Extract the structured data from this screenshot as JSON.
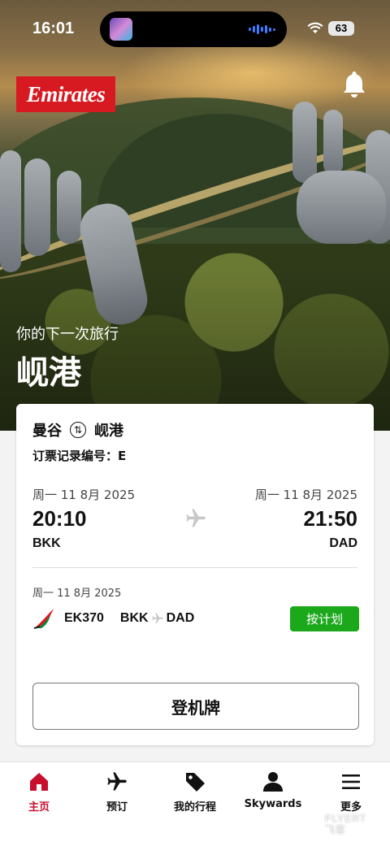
{
  "status_bar": {
    "time": "16:01",
    "battery": "63"
  },
  "brand": {
    "logo_text": "Emirates",
    "color": "#d71921"
  },
  "hero": {
    "subtitle": "你的下一次旅行",
    "destination": "岘港"
  },
  "trip_card": {
    "origin_city": "曼谷",
    "destination_city": "岘港",
    "booking_ref_label": "订票记录编号：E",
    "departure": {
      "date": "周一 11 8月 2025",
      "time": "20:10",
      "code": "BKK"
    },
    "arrival": {
      "date": "周一 11 8月 2025",
      "time": "21:50",
      "code": "DAD"
    },
    "segment": {
      "date": "周一 11 8月 2025",
      "flight_number": "EK370",
      "from": "BKK",
      "to": "DAD",
      "status": "按计划",
      "status_color": "#1ba81b"
    },
    "boarding_pass_label": "登机牌"
  },
  "bottom_nav": {
    "active_color": "#c8102e",
    "items": [
      {
        "label": "主页",
        "icon": "home-icon"
      },
      {
        "label": "预订",
        "icon": "airplane-icon"
      },
      {
        "label": "我的行程",
        "icon": "tag-icon"
      },
      {
        "label": "Skywards",
        "icon": "person-icon"
      },
      {
        "label": "更多",
        "icon": "menu-icon"
      }
    ]
  },
  "watermark": "FLYERT\n飞客"
}
